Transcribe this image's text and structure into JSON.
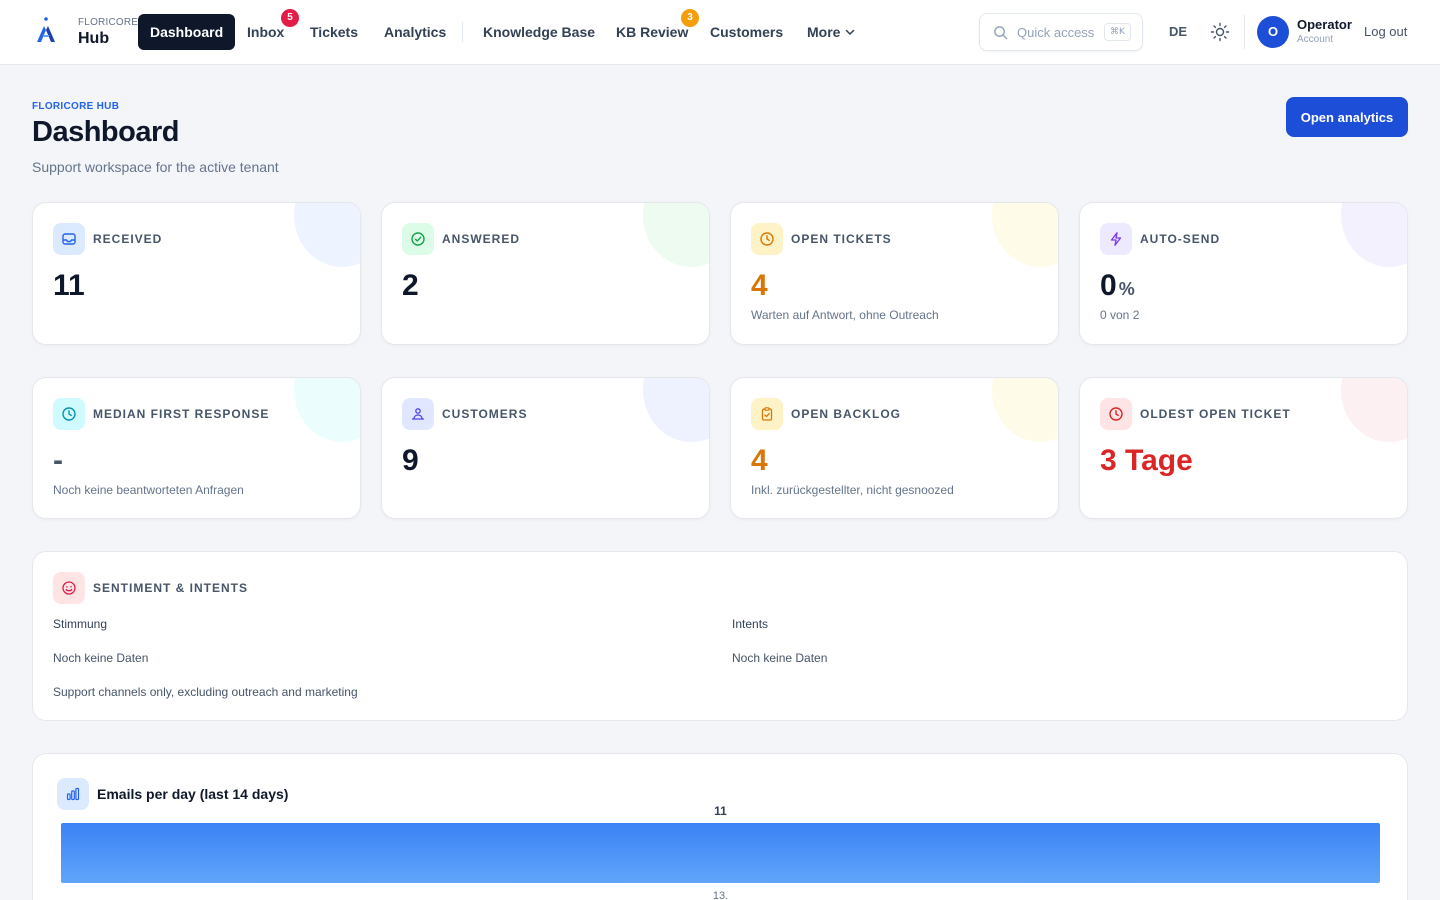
{
  "brand": {
    "small": "FLORICORE",
    "name": "Hub"
  },
  "nav": {
    "dashboard": "Dashboard",
    "inbox": "Inbox",
    "inbox_badge": "5",
    "tickets": "Tickets",
    "analytics": "Analytics",
    "knowledge_base": "Knowledge Base",
    "kb_review": "KB Review",
    "kb_review_badge": "3",
    "customers": "Customers",
    "more": "More"
  },
  "quick_access": {
    "placeholder": "Quick access",
    "shortcut": "⌘K"
  },
  "language": "DE",
  "user": {
    "initial": "O",
    "name": "Operator",
    "role": "Account",
    "logout": "Log out"
  },
  "header": {
    "eyebrow": "FLORICORE HUB",
    "title": "Dashboard",
    "subtitle": "Support workspace for the active tenant",
    "primary_action": "Open analytics"
  },
  "stats": {
    "received": {
      "label": "RECEIVED",
      "value": "11"
    },
    "answered": {
      "label": "ANSWERED",
      "value": "2"
    },
    "open_tickets": {
      "label": "OPEN TICKETS",
      "value": "4",
      "sub": "Warten auf Antwort, ohne Outreach"
    },
    "auto_send": {
      "label": "AUTO-SEND",
      "value": "0",
      "unit": "%",
      "sub": "0 von 2"
    },
    "median_first_response": {
      "label": "MEDIAN FIRST RESPONSE",
      "value": "-",
      "sub": "Noch keine beantworteten Anfragen"
    },
    "customers": {
      "label": "CUSTOMERS",
      "value": "9"
    },
    "open_backlog": {
      "label": "OPEN BACKLOG",
      "value": "4",
      "sub": "Inkl. zurückgestellter, nicht gesnoozed"
    },
    "oldest_open_ticket": {
      "label": "OLDEST OPEN TICKET",
      "value": "3 Tage"
    }
  },
  "sentiment": {
    "label": "SENTIMENT & INTENTS",
    "mood_title": "Stimmung",
    "mood_empty": "Noch keine Daten",
    "intents_title": "Intents",
    "intents_empty": "Noch keine Daten",
    "footnote": "Support channels only, excluding outreach and marketing"
  },
  "colors": {
    "accent": "#1d4ed8",
    "nav_active": "#0f172a",
    "badge_red": "#e11d48",
    "badge_orange": "#f59e0b",
    "warning_value": "#d97706",
    "danger_value": "#dc2626",
    "bar": "#3b82f6"
  },
  "chart_data": {
    "type": "bar",
    "title": "Emails per day (last 14 days)",
    "categories": [
      "13."
    ],
    "values": [
      11
    ],
    "ylim": [
      0,
      11
    ],
    "grid": false,
    "legend": "none"
  }
}
